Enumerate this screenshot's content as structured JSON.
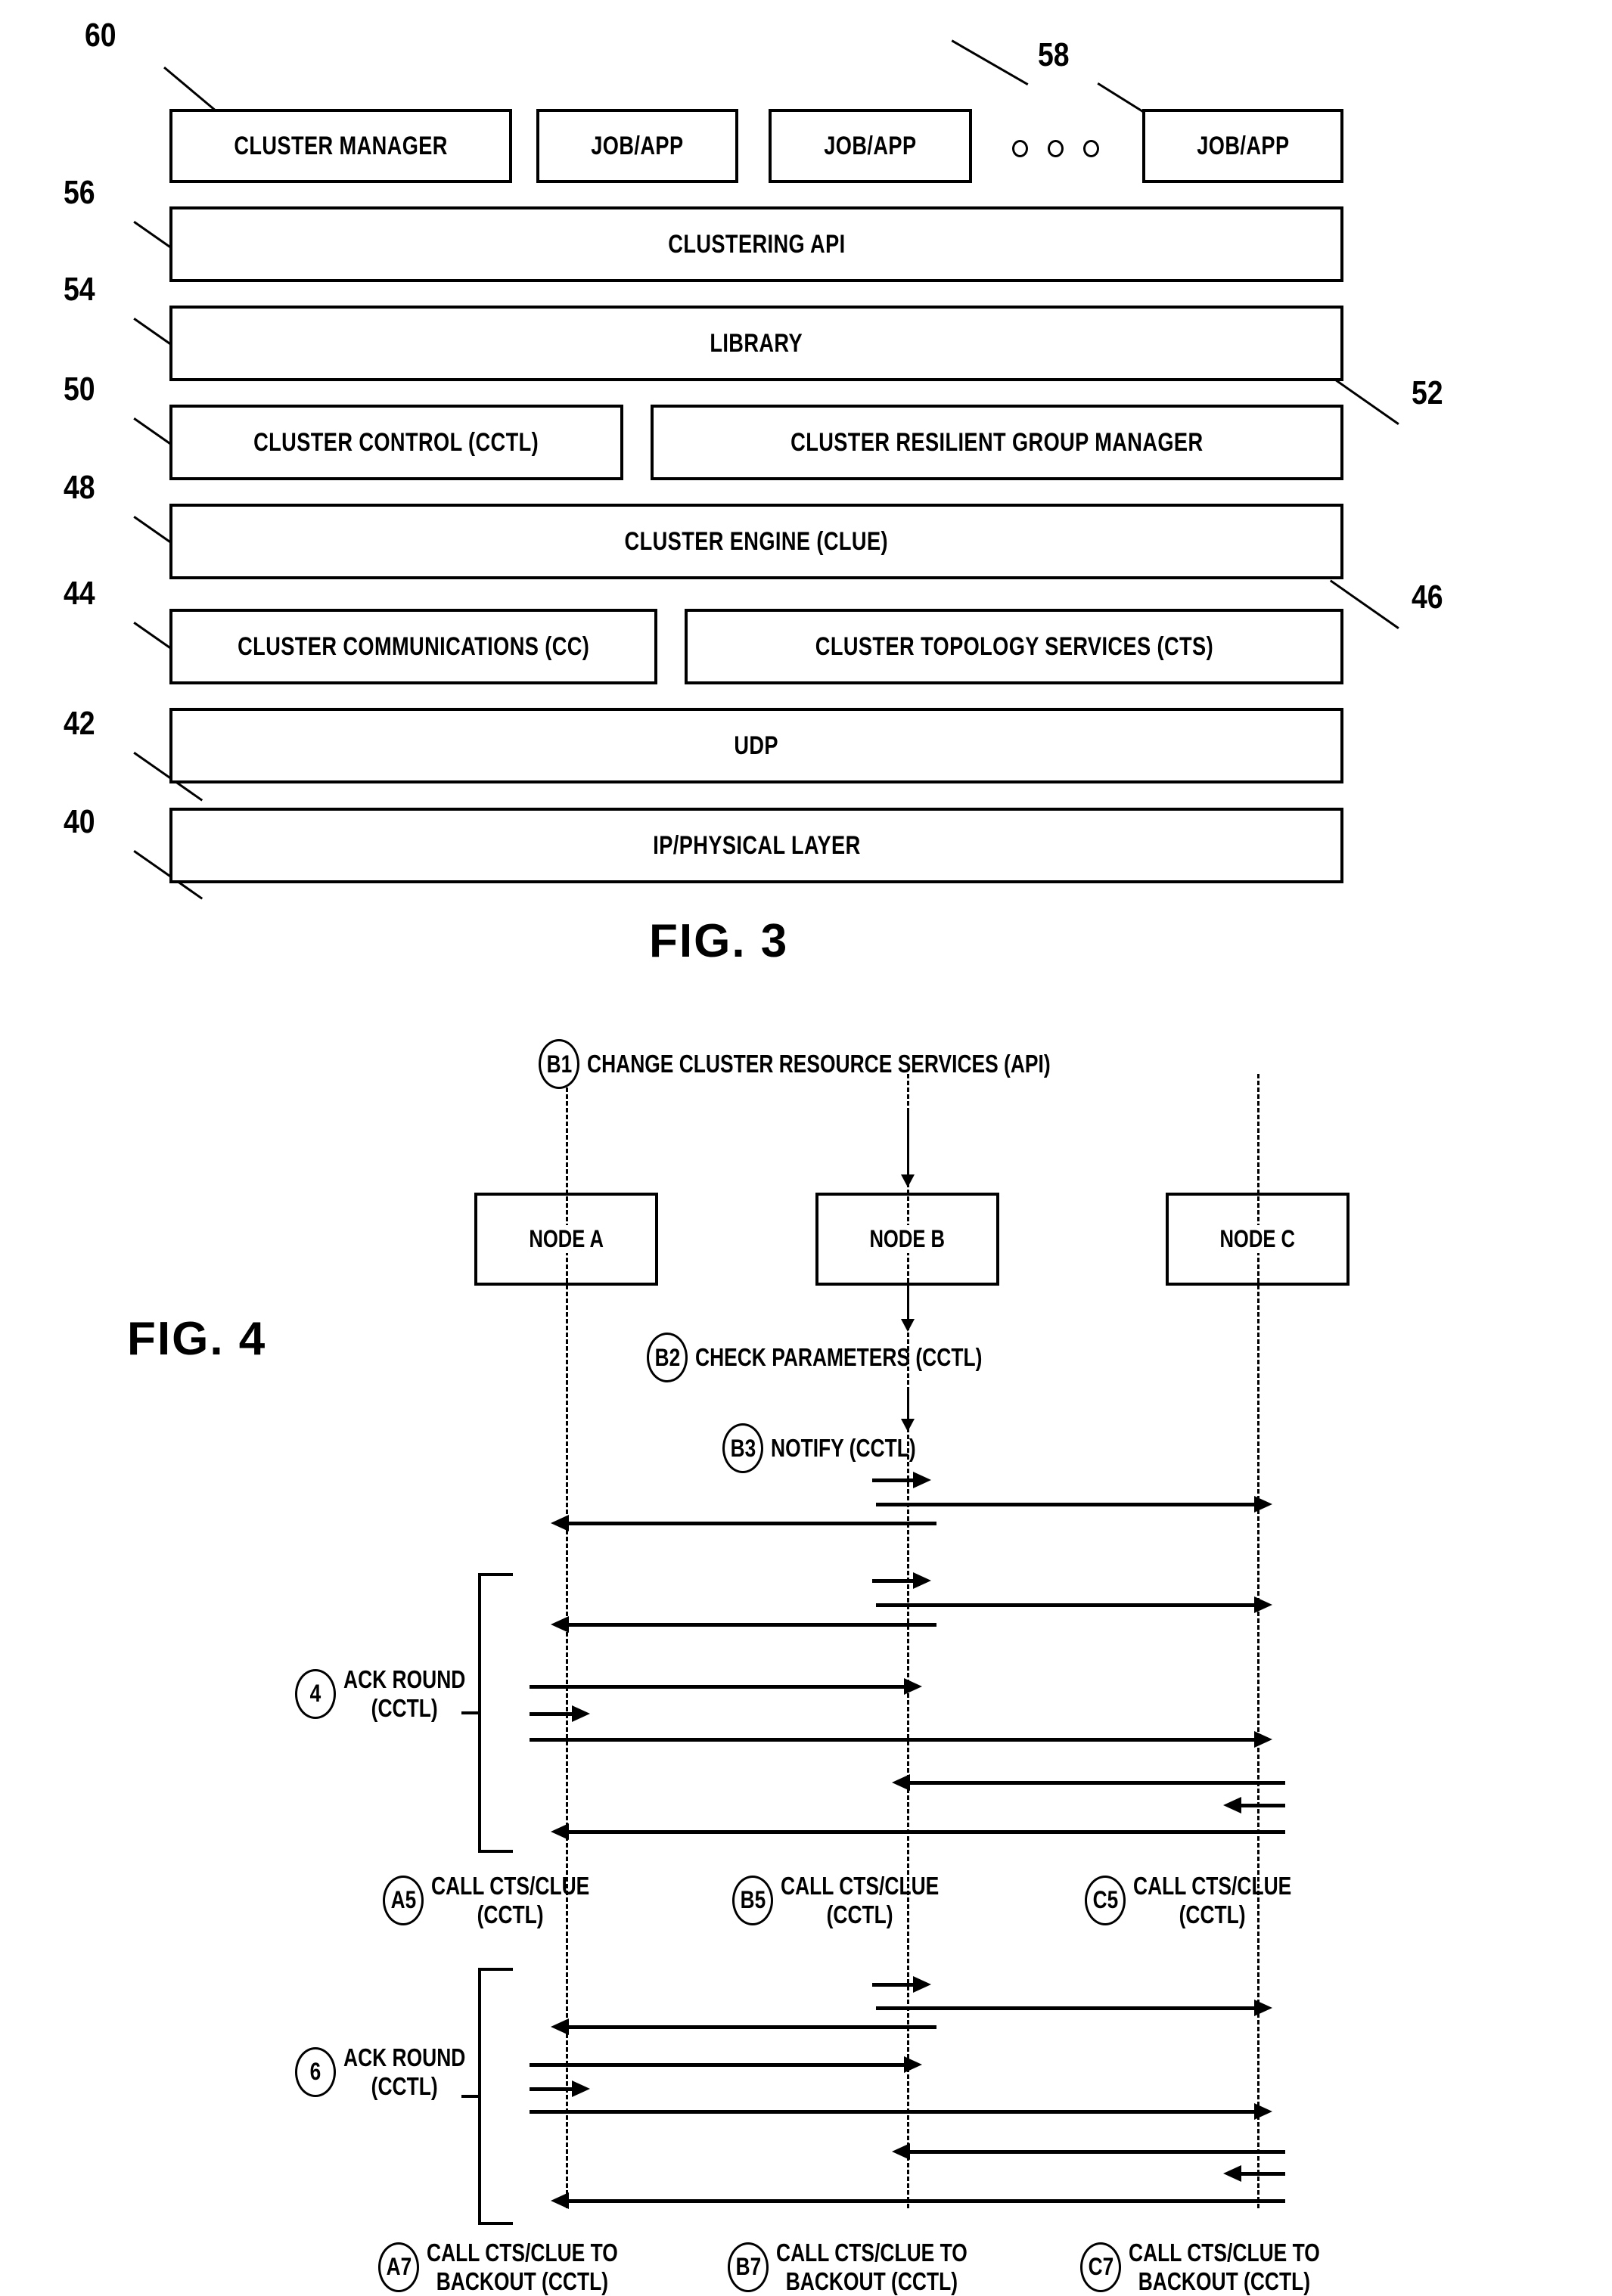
{
  "figures": [
    {
      "caption": "FIG. 3",
      "type": "layered-block-diagram",
      "layers": [
        {
          "ref": "60",
          "boxes": [
            {
              "label": "CLUSTER MANAGER"
            }
          ]
        },
        {
          "ref": "58",
          "boxes": [
            {
              "label": "JOB/APP"
            },
            {
              "label": "JOB/APP"
            },
            {
              "label": "JOB/APP"
            }
          ],
          "ellipsis": "o o o"
        },
        {
          "ref": "56",
          "boxes": [
            {
              "label": "CLUSTERING API"
            }
          ]
        },
        {
          "ref": "54",
          "boxes": [
            {
              "label": "LIBRARY"
            }
          ]
        },
        {
          "ref": "50",
          "boxes": [
            {
              "label": "CLUSTER CONTROL (CCTL)"
            }
          ]
        },
        {
          "ref": "52",
          "boxes": [
            {
              "label": "CLUSTER RESILIENT GROUP MANAGER"
            }
          ]
        },
        {
          "ref": "48",
          "boxes": [
            {
              "label": "CLUSTER ENGINE (CLUE)"
            }
          ]
        },
        {
          "ref": "44",
          "boxes": [
            {
              "label": "CLUSTER COMMUNICATIONS (CC)"
            }
          ]
        },
        {
          "ref": "46",
          "boxes": [
            {
              "label": "CLUSTER TOPOLOGY SERVICES (CTS)"
            }
          ]
        },
        {
          "ref": "42",
          "boxes": [
            {
              "label": "UDP"
            }
          ]
        },
        {
          "ref": "40",
          "boxes": [
            {
              "label": "IP/PHYSICAL LAYER"
            }
          ]
        }
      ]
    },
    {
      "caption": "FIG. 4",
      "type": "sequence-diagram",
      "nodes": [
        {
          "label": "NODE A"
        },
        {
          "label": "NODE B"
        },
        {
          "label": "NODE C"
        }
      ],
      "steps": [
        {
          "id": "B1",
          "text": "CHANGE CLUSTER RESOURCE SERVICES (API)"
        },
        {
          "id": "B2",
          "text": "CHECK PARAMETERS (CCTL)"
        },
        {
          "id": "B3",
          "text": "NOTIFY (CCTL)"
        },
        {
          "id": "4",
          "text": "ACK ROUND\n(CCTL)"
        },
        {
          "id": "A5",
          "text": "CALL CTS/CLUE\n(CCTL)"
        },
        {
          "id": "B5",
          "text": "CALL CTS/CLUE\n(CCTL)"
        },
        {
          "id": "C5",
          "text": "CALL CTS/CLUE\n(CCTL)"
        },
        {
          "id": "6",
          "text": "ACK ROUND\n(CCTL)"
        },
        {
          "id": "A7",
          "text": "CALL CTS/CLUE TO\nBACKOUT (CCTL)"
        },
        {
          "id": "B7",
          "text": "CALL CTS/CLUE TO\nBACKOUT (CCTL)"
        },
        {
          "id": "C7",
          "text": "CALL CTS/CLUE TO\nBACKOUT (CCTL)"
        }
      ]
    }
  ],
  "f3": {
    "ref60": "60",
    "ref58": "58",
    "ref56": "56",
    "ref54": "54",
    "ref50": "50",
    "ref52": "52",
    "ref48": "48",
    "ref44": "44",
    "ref46": "46",
    "ref42": "42",
    "ref40": "40",
    "b_cluster_manager": "CLUSTER MANAGER",
    "b_job1": "JOB/APP",
    "b_job2": "JOB/APP",
    "b_job3": "JOB/APP",
    "b_clustering_api": "CLUSTERING API",
    "b_library": "LIBRARY",
    "b_cluster_control": "CLUSTER CONTROL (CCTL)",
    "b_crgm": "CLUSTER RESILIENT GROUP MANAGER",
    "b_clue": "CLUSTER ENGINE (CLUE)",
    "b_cc": "CLUSTER COMMUNICATIONS (CC)",
    "b_cts": "CLUSTER TOPOLOGY SERVICES (CTS)",
    "b_udp": "UDP",
    "b_ip": "IP/PHYSICAL LAYER",
    "caption": "FIG. 3"
  },
  "f4": {
    "caption": "FIG. 4",
    "node_a": "NODE A",
    "node_b": "NODE B",
    "node_c": "NODE C",
    "b1_id": "B1",
    "b1_text": "CHANGE CLUSTER RESOURCE SERVICES (API)",
    "b2_id": "B2",
    "b2_text": "CHECK PARAMETERS (CCTL)",
    "b3_id": "B3",
    "b3_text": "NOTIFY (CCTL)",
    "ack4_id": "4",
    "ack4_l1": "ACK ROUND",
    "ack4_l2": "(CCTL)",
    "a5_id": "A5",
    "a5_l1": "CALL CTS/CLUE",
    "a5_l2": "(CCTL)",
    "b5_id": "B5",
    "b5_l1": "CALL CTS/CLUE",
    "b5_l2": "(CCTL)",
    "c5_id": "C5",
    "c5_l1": "CALL CTS/CLUE",
    "c5_l2": "(CCTL)",
    "ack6_id": "6",
    "ack6_l1": "ACK ROUND",
    "ack6_l2": "(CCTL)",
    "a7_id": "A7",
    "a7_l1": "CALL CTS/CLUE TO",
    "a7_l2": "BACKOUT (CCTL)",
    "b7_id": "B7",
    "b7_l1": "CALL CTS/CLUE TO",
    "b7_l2": "BACKOUT (CCTL)",
    "c7_id": "C7",
    "c7_l1": "CALL CTS/CLUE TO",
    "c7_l2": "BACKOUT (CCTL)"
  }
}
